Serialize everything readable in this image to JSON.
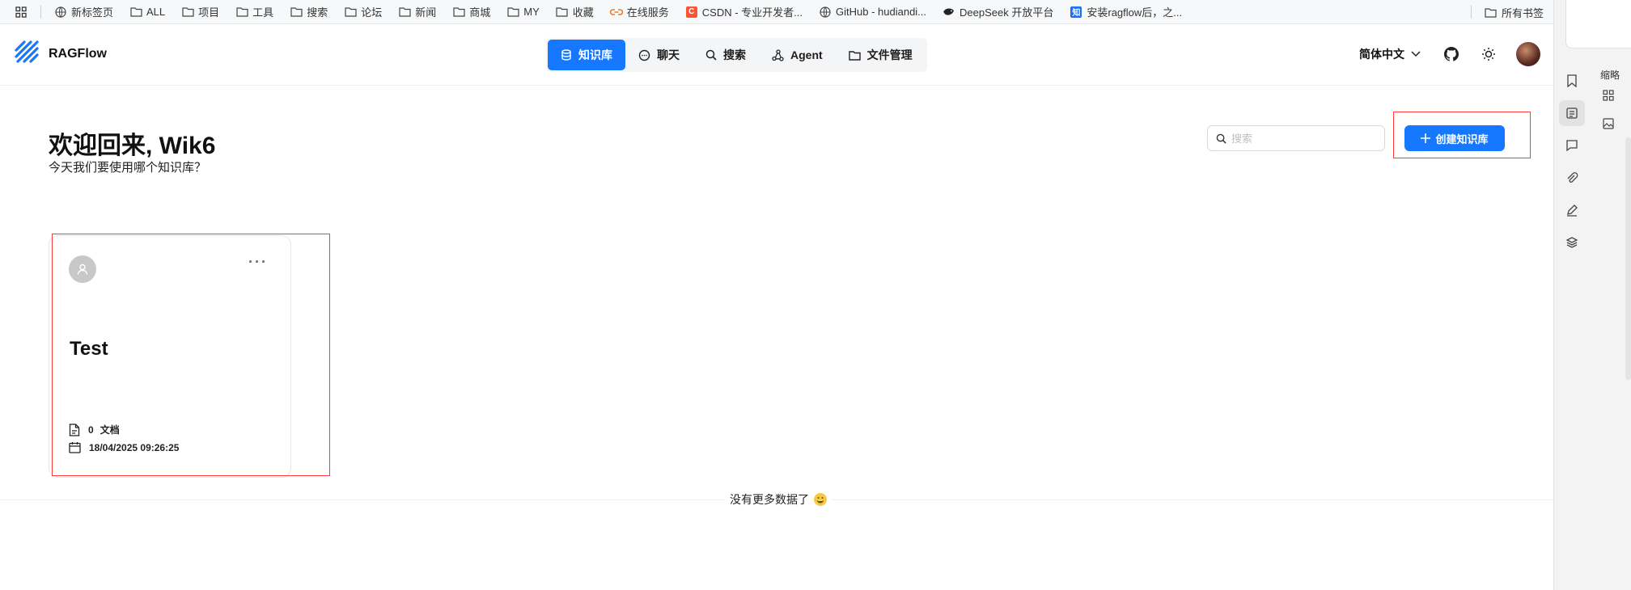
{
  "bookmarks": {
    "items": [
      {
        "label": "新标签页",
        "icon": "globe-icon"
      },
      {
        "label": "ALL",
        "icon": "folder-icon"
      },
      {
        "label": "项目",
        "icon": "folder-icon"
      },
      {
        "label": "工具",
        "icon": "folder-icon"
      },
      {
        "label": "搜索",
        "icon": "folder-icon"
      },
      {
        "label": "论坛",
        "icon": "folder-icon"
      },
      {
        "label": "新闻",
        "icon": "folder-icon"
      },
      {
        "label": "商城",
        "icon": "folder-icon"
      },
      {
        "label": "MY",
        "icon": "folder-icon"
      },
      {
        "label": "收藏",
        "icon": "folder-icon"
      },
      {
        "label": "在线服务",
        "icon": "link-icon"
      },
      {
        "label": "CSDN - 专业开发者...",
        "icon": "csdn-icon"
      },
      {
        "label": "GitHub - hudiandi...",
        "icon": "globe-icon"
      },
      {
        "label": "DeepSeek 开放平台",
        "icon": "deepseek-icon"
      },
      {
        "label": "安装ragflow后，之...",
        "icon": "zhihu-icon"
      }
    ],
    "csdn_letter": "C",
    "zhihu_letter": "知",
    "all_bookmarks": "所有书签"
  },
  "header": {
    "app_name": "RAGFlow",
    "nav": [
      {
        "label": "知识库",
        "icon": "database-icon",
        "active": true
      },
      {
        "label": "聊天",
        "icon": "chat-icon",
        "active": false
      },
      {
        "label": "搜索",
        "icon": "search-icon",
        "active": false
      },
      {
        "label": "Agent",
        "icon": "agent-icon",
        "active": false
      },
      {
        "label": "文件管理",
        "icon": "folder-icon",
        "active": false
      }
    ],
    "language": "简体中文"
  },
  "main": {
    "welcome": "欢迎回来, Wik6",
    "subtitle": "今天我们要使用哪个知识库？",
    "search_placeholder": "搜索",
    "create_label": "创建知识库",
    "cards": [
      {
        "title": "Test",
        "doc_count": "0",
        "doc_label": "文档",
        "date": "18/04/2025 09:26:25"
      }
    ],
    "no_more": "没有更多数据了"
  },
  "sidepanel": {
    "label": "缩略"
  },
  "colors": {
    "primary": "#1677ff",
    "highlight_box": "#ff3b3b"
  }
}
